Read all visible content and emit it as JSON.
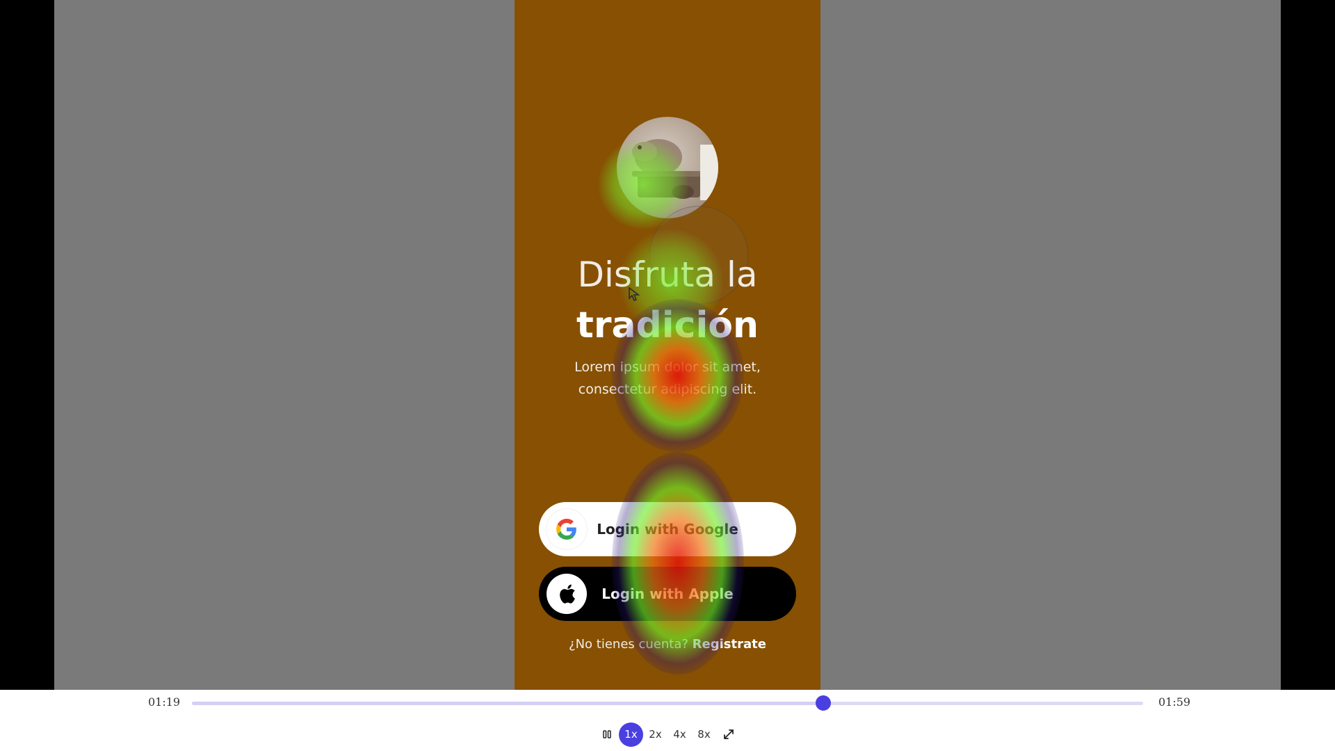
{
  "app": {
    "headline_line1": "Disfruta la",
    "headline_line2": "tradición",
    "subtitle": "Lorem ipsum dolor sit amet, consectetur adipiscing elit.",
    "google_button_label": "Login with Google",
    "apple_button_label": "Login with Apple",
    "signup_prompt": "¿No tienes cuenta?",
    "signup_link": "Registrate",
    "avatar_icon": "capybara-avatar",
    "google_icon": "google-g-icon",
    "apple_icon": "apple-icon"
  },
  "player": {
    "current_time": "01:19",
    "total_time": "01:59",
    "progress_fraction": 0.664,
    "pause_icon": "pause-icon",
    "fullscreen_icon": "fullscreen-icon",
    "speeds": [
      "1x",
      "2x",
      "4x",
      "8x"
    ],
    "active_speed": "1x"
  },
  "colors": {
    "phone_background": "#875002",
    "canvas_gray": "#7a7a7a",
    "accent": "#4a3fe0",
    "track": "#ddd9f7"
  }
}
